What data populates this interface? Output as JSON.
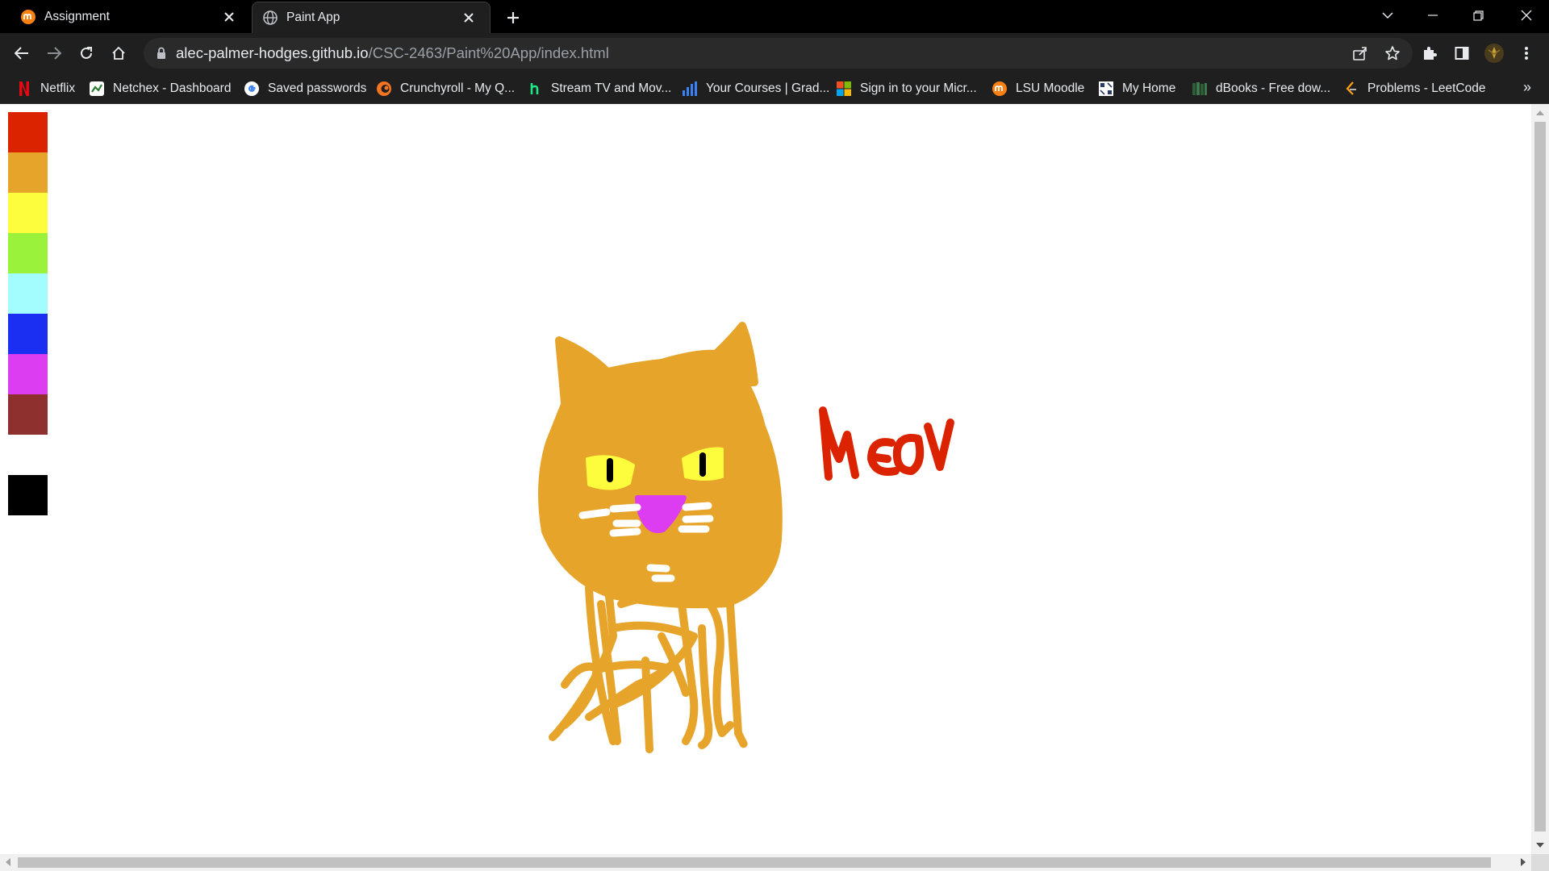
{
  "tabs": [
    {
      "title": "Assignment",
      "icon": "moodle-icon",
      "active": false
    },
    {
      "title": "Paint App",
      "icon": "globe-icon",
      "active": true
    }
  ],
  "address_bar": {
    "host": "alec-palmer-hodges.github.io",
    "path": "/CSC-2463/Paint%20App/index.html"
  },
  "bookmarks": [
    {
      "label": "Netflix",
      "icon": "netflix-icon",
      "color": "#e50914"
    },
    {
      "label": "Netchex - Dashboard",
      "icon": "netchex-icon",
      "color": "#2e7d32"
    },
    {
      "label": "Saved passwords",
      "icon": "google-icon",
      "color": "#4285f4"
    },
    {
      "label": "Crunchyroll - My Q...",
      "icon": "crunchyroll-icon",
      "color": "#f47521"
    },
    {
      "label": "Stream TV and Mov...",
      "icon": "hulu-icon",
      "color": "#1ce783"
    },
    {
      "label": "Your Courses | Grad...",
      "icon": "bar-chart-icon",
      "color": "#3b82f6"
    },
    {
      "label": "Sign in to your Micr...",
      "icon": "microsoft-icon",
      "color": "#f25022"
    },
    {
      "label": "LSU Moodle",
      "icon": "moodle-icon",
      "color": "#f98012"
    },
    {
      "label": "My Home",
      "icon": "home-grid-icon",
      "color": "#ffffff"
    },
    {
      "label": "dBooks - Free dow...",
      "icon": "book-icon",
      "color": "#2f5d3a"
    },
    {
      "label": "Problems - LeetCode",
      "icon": "leetcode-icon",
      "color": "#ffa116"
    }
  ],
  "palette": [
    {
      "name": "red",
      "color": "#dc2300"
    },
    {
      "name": "orange",
      "color": "#e6a42b"
    },
    {
      "name": "yellow",
      "color": "#fdfd3d"
    },
    {
      "name": "green",
      "color": "#9af23a"
    },
    {
      "name": "cyan",
      "color": "#a3fcfd"
    },
    {
      "name": "blue",
      "color": "#1b2ff3"
    },
    {
      "name": "magenta",
      "color": "#dd3df0"
    },
    {
      "name": "brown",
      "color": "#8e302d"
    },
    {
      "name": "white",
      "color": "#ffffff"
    },
    {
      "name": "black",
      "color": "#000000"
    }
  ],
  "drawing": {
    "cat_color": "#e6a42b",
    "eye_color": "#fdfd3d",
    "pupil_color": "#000000",
    "nose_color": "#dd3df0",
    "whisker_color": "#ffffff",
    "text_color": "#dc2300"
  }
}
